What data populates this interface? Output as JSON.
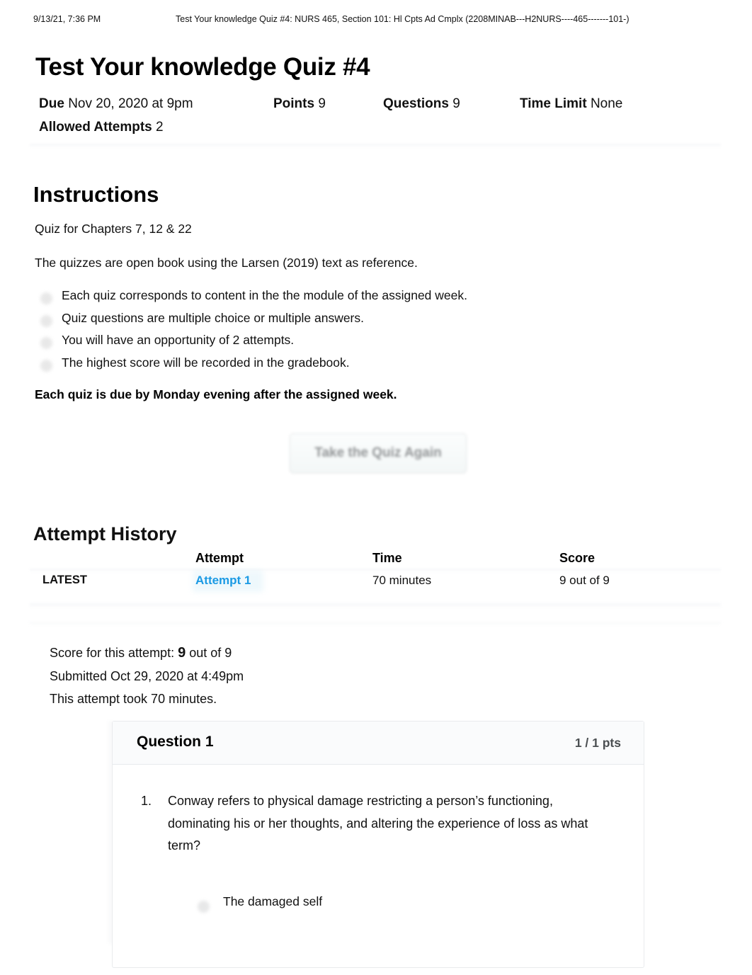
{
  "print_header": {
    "timestamp": "9/13/21, 7:36 PM",
    "document_title": "Test Your knowledge Quiz #4: NURS 465, Section 101: Hl Cpts Ad Cmplx (2208MINAB---H2NURS----465-------101-)"
  },
  "quiz": {
    "title": "Test Your knowledge Quiz #4",
    "meta": {
      "due_label": "Due",
      "due_value": "Nov 20, 2020 at 9pm",
      "points_label": "Points",
      "points_value": "9",
      "questions_label": "Questions",
      "questions_value": "9",
      "time_limit_label": "Time Limit",
      "time_limit_value": "None",
      "allowed_attempts_label": "Allowed Attempts",
      "allowed_attempts_value": "2"
    }
  },
  "instructions": {
    "heading": "Instructions",
    "paragraph_1": "Quiz for Chapters 7, 12 & 22",
    "paragraph_2": "The quizzes are open book using the Larsen (2019) text as reference.",
    "bullets": [
      "Each quiz corresponds to content in the the module of the assigned week.",
      "Quiz questions are multiple choice or multiple answers.",
      "You will have an opportunity of 2 attempts.",
      "The highest score will be recorded in the gradebook."
    ],
    "closing_bold": "Each quiz is due by Monday evening after the assigned week."
  },
  "actions": {
    "retake_button_label": "Take the Quiz Again"
  },
  "attempt_history": {
    "heading": "Attempt History",
    "columns": [
      "",
      "Attempt",
      "Time",
      "Score"
    ],
    "rows": [
      {
        "kind": "LATEST",
        "attempt": "Attempt 1",
        "time": "70 minutes",
        "score": "9 out of 9"
      }
    ]
  },
  "score_summary": {
    "score_prefix": "Score for this attempt:",
    "score_value": "9",
    "score_suffix": "out of 9",
    "submitted": "Submitted Oct 29, 2020 at 4:49pm",
    "duration": "This attempt took 70 minutes."
  },
  "question": {
    "label": "Question 1",
    "points": "1 / 1 pts",
    "number": "1.",
    "text": "Conway refers to physical damage restricting a person’s functioning, dominating his or her thoughts, and altering the experience of loss as what term?",
    "answers": [
      {
        "label": "The damaged self"
      }
    ]
  },
  "colors": {
    "link_blue": "#1b9ae4",
    "text_black": "#111111",
    "muted_gray": "#8a8d8f",
    "card_border": "#e2e4e7"
  }
}
